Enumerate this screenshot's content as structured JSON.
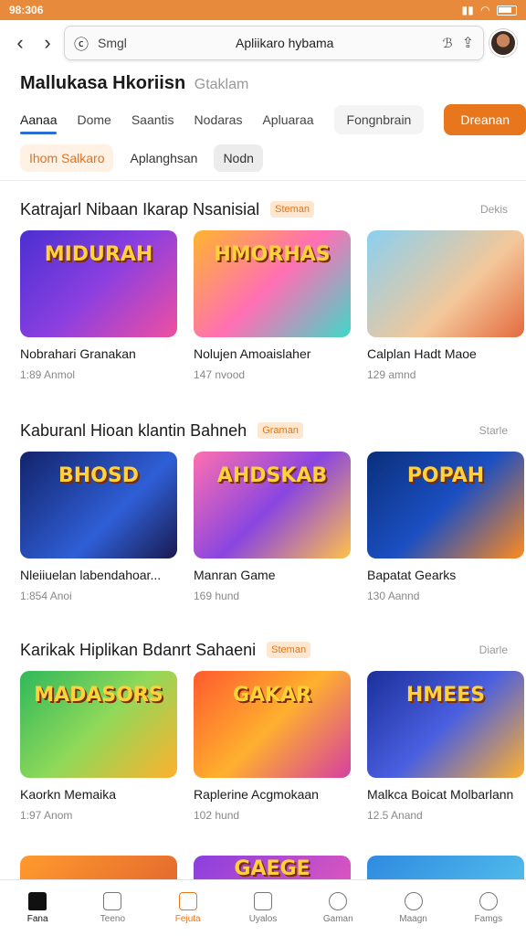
{
  "status": {
    "time": "98:306"
  },
  "browser": {
    "search_label": "Smgl",
    "url": "Apliikaro hybama"
  },
  "title": {
    "main": "Mallukasa Hkoriisn",
    "sub": "Gtaklam"
  },
  "tabs": [
    "Aanaa",
    "Dome",
    "Saantis",
    "Nodaras",
    "Apluaraa"
  ],
  "tab_pill": "Fongnbrain",
  "tab_cta": "Dreanan",
  "chips": [
    "Ihom Salkaro",
    "Aplanghsan",
    "Nodn"
  ],
  "sections": [
    {
      "title": "Katrajarl Nibaan Ikarap Nsanisial",
      "badge": "Steman",
      "see_all": "Dekis",
      "cards": [
        {
          "name": "Nobrahari Granakan",
          "meta": "1:89 Anmol",
          "art": "MIDURAH",
          "bg": "linear-gradient(135deg,#4a2fd1,#8b3fe0 50%,#f04fa0)"
        },
        {
          "name": "Nolujen Amoaislaher",
          "meta": "147 nvood",
          "art": "HMORHAS",
          "bg": "linear-gradient(135deg,#ffb52e,#ff6fb4 50%,#3fd8c8)"
        },
        {
          "name": "Calplan Hadt Maoe",
          "meta": "129 amnd",
          "art": "",
          "bg": "linear-gradient(135deg,#8ad0f0,#f4c79a 60%,#e36a3e)"
        }
      ]
    },
    {
      "title": "Kaburanl Hioan klantin Bahneh",
      "badge": "Graman",
      "see_all": "Starle",
      "cards": [
        {
          "name": "Nleiiuelan labendahoar...",
          "meta": "1:854 Anoi",
          "art": "BHOSD",
          "bg": "linear-gradient(135deg,#13236b,#2f5fd6 60%,#1a1a50)"
        },
        {
          "name": "Manran Game",
          "meta": "169 hund",
          "art": "AHDSKAB",
          "bg": "linear-gradient(135deg,#ff6fb0,#8a45e0 50%,#ffc14a)"
        },
        {
          "name": "Bapatat Gearks",
          "meta": "130 Aannd",
          "art": "POPAH",
          "bg": "linear-gradient(135deg,#0a2f7a,#1b4fc2 50%,#ff8a1e)"
        }
      ]
    },
    {
      "title": "Karikak Hiplikan Bdanrt Sahaeni",
      "badge": "Steman",
      "see_all": "Diarle",
      "cards": [
        {
          "name": "Kaorkn Memaika",
          "meta": "1:97 Anom",
          "art": "MADASORS",
          "bg": "linear-gradient(135deg,#2fb85a,#8fd95a 50%,#ffb02e)"
        },
        {
          "name": "Raplerine Acgmokaan",
          "meta": "102 hund",
          "art": "GAKAR",
          "bg": "linear-gradient(135deg,#ff5a2e,#ffb02e 50%,#d63fa0)"
        },
        {
          "name": "Malkca Boicat Molbarlann",
          "meta": "12.5 Anand",
          "art": "HMEES",
          "bg": "linear-gradient(135deg,#1b2f9a,#4a5fe0 50%,#ffb02e)"
        }
      ]
    }
  ],
  "peek_row": {
    "art": "GAEGE"
  },
  "bottom_nav": [
    "Fana",
    "Teeno",
    "Fejuta",
    "Uyalos",
    "Gaman",
    "Maagn",
    "Famgs"
  ]
}
